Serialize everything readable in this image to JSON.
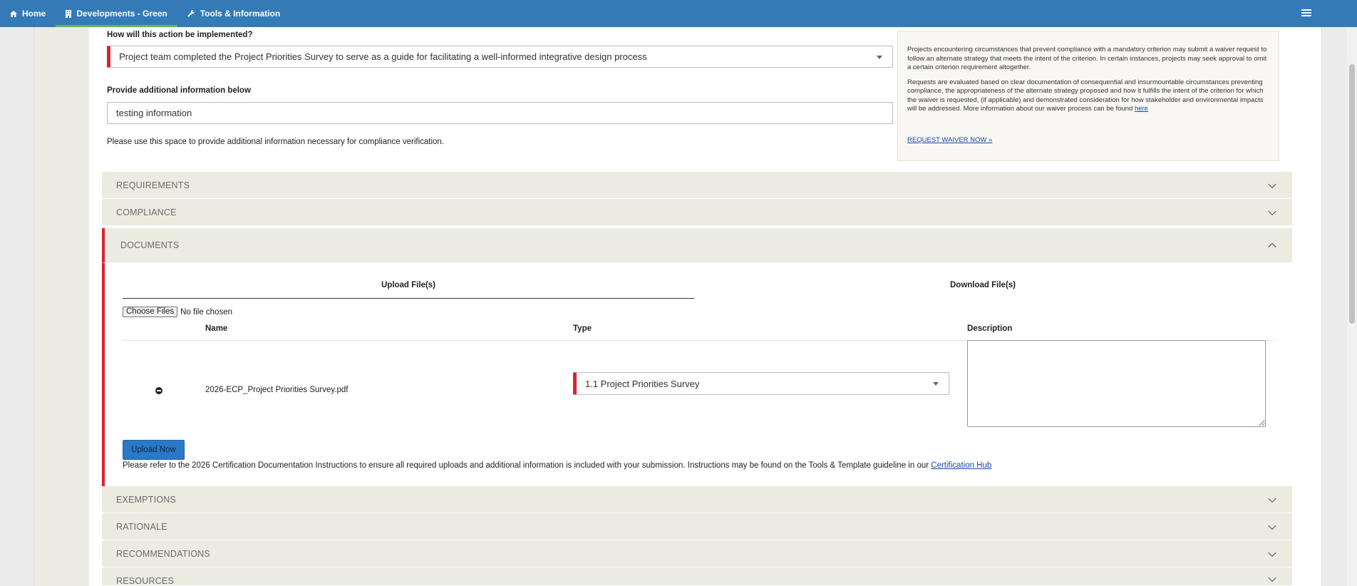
{
  "nav": {
    "home": "Home",
    "developments": "Developments - Green",
    "tools": "Tools & Information"
  },
  "question": {
    "label": "How will this action be implemented?",
    "selected": "Project team completed the Project Priorities Survey to serve as a guide for facilitating a well-informed integrative design process"
  },
  "additional": {
    "label": "Provide additional information below",
    "value": "testing information",
    "help": "Please use this space to provide additional information necessary for compliance verification."
  },
  "waiver": {
    "p1": "Projects encountering circumstances that prevent compliance with a mandatory criterion may submit a waiver request to follow an alternate strategy that meets the intent of the criterion. In certain instances, projects may seek approval to omit a certain criterion requirement altogether.",
    "p2": "Requests are evaluated based on clear documentation of consequential and insurmountable circumstances preventing compliance, the appropriateness of the alternate strategy proposed and how it fulfills the intent of the criterion for which the waiver is requested, (if applicable) and demonstrated consideration for how stakeholder and environmental impacts will be addressed. More information about our waiver process can be found",
    "here_link": "here",
    "request_link": "REQUEST WAIVER NOW »"
  },
  "sections": {
    "requirements": "REQUIREMENTS",
    "compliance": "COMPLIANCE",
    "documents": "DOCUMENTS",
    "exemptions": "EXEMPTIONS",
    "rationale": "RATIONALE",
    "recommendations": "RECOMMENDATIONS",
    "resources": "RESOURCES"
  },
  "documents": {
    "tab_upload": "Upload File(s)",
    "tab_download": "Download File(s)",
    "choose_button": "Choose Files",
    "no_file": "No file chosen",
    "columns": {
      "name": "Name",
      "type": "Type",
      "description": "Description"
    },
    "row": {
      "name": "2026-ECP_Project Priorities Survey.pdf",
      "type": "1.1 Project Priorities Survey",
      "description": ""
    },
    "upload_button": "Upload Now",
    "refer_text": "Please refer to the 2026 Certification Documentation Instructions to ensure all required uploads and additional information is included with your submission. Instructions may be found on the Tools & Template guideline in our",
    "hub_link": "Certification Hub"
  },
  "colors": {
    "nav_bg": "#337ab7",
    "required_marker": "#d9232e",
    "accordion_bg": "#ecebe2",
    "upload_btn": "#2b78c6"
  }
}
